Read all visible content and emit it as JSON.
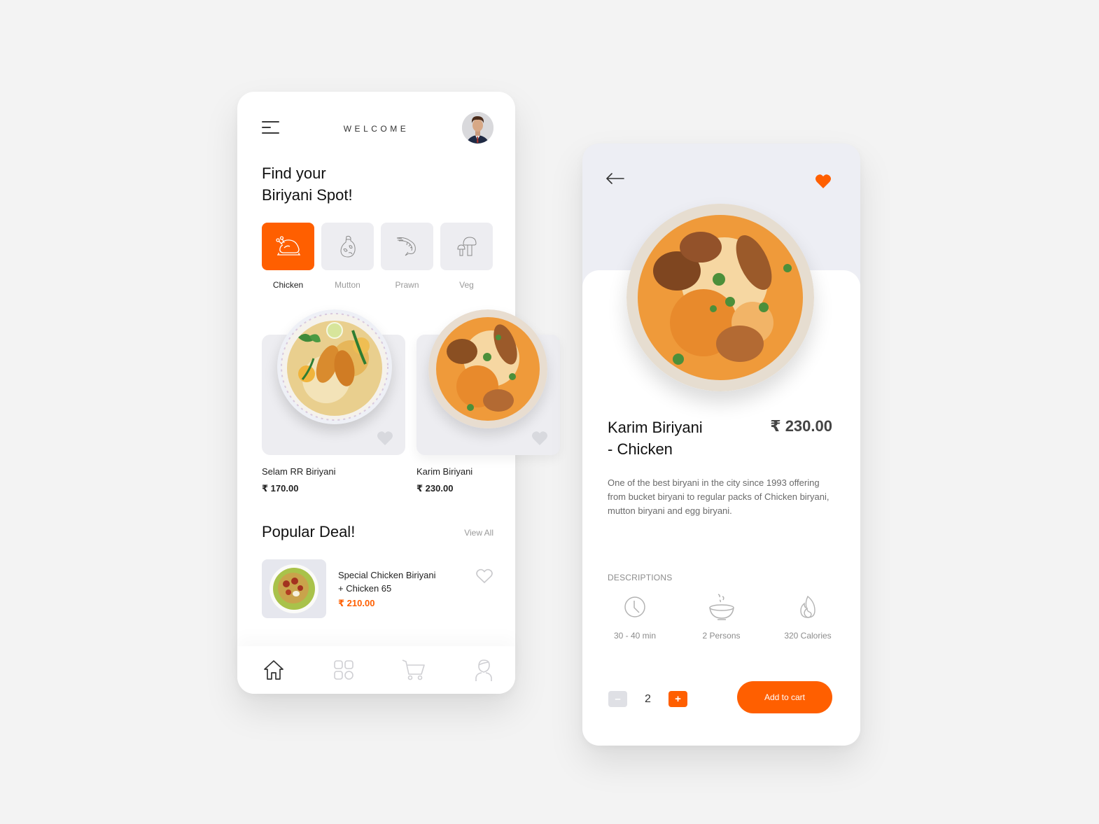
{
  "home": {
    "header": {
      "title": "WELCOME",
      "menu_icon": "hamburger-menu-icon",
      "avatar_icon": "user-avatar"
    },
    "headline": [
      "Find your",
      "Biriyani Spot!"
    ],
    "categories": [
      {
        "label": "Chicken",
        "icon": "chicken-icon",
        "active": true
      },
      {
        "label": "Mutton",
        "icon": "mutton-icon",
        "active": false
      },
      {
        "label": "Prawn",
        "icon": "prawn-icon",
        "active": false
      },
      {
        "label": "Veg",
        "icon": "mushroom-icon",
        "active": false
      }
    ],
    "featured": [
      {
        "name": "Selam RR Biriyani",
        "price": "₹ 170.00",
        "favorite": false
      },
      {
        "name": "Karim Biriyani",
        "price": "₹ 230.00",
        "favorite": false
      }
    ],
    "popular": {
      "title": "Popular Deal!",
      "view_all": "View All",
      "items": [
        {
          "name_line1": "Special Chicken Biriyani",
          "name_line2": "+ Chicken 65",
          "price": "₹ 210.00",
          "favorite": false
        }
      ]
    },
    "tabbar": [
      {
        "name": "home",
        "icon": "home-icon",
        "active": true
      },
      {
        "name": "categories",
        "icon": "grid-icon",
        "active": false
      },
      {
        "name": "cart",
        "icon": "cart-icon",
        "active": false
      },
      {
        "name": "profile",
        "icon": "profile-icon",
        "active": false
      }
    ]
  },
  "detail": {
    "title_line1": "Karim Biriyani",
    "title_line2": "- Chicken",
    "price": "₹ 230.00",
    "favorite": true,
    "description": "One of the best biryani in the city since 1993 offering from bucket biryani to regular packs of Chicken biryani, mutton biryani and egg biryani.",
    "section_label": "DESCRIPTIONS",
    "stats": [
      {
        "icon": "clock-icon",
        "label": "30 - 40 min"
      },
      {
        "icon": "bowl-icon",
        "label": "2 Persons"
      },
      {
        "icon": "flame-icon",
        "label": "320 Calories"
      }
    ],
    "quantity": {
      "minus": "–",
      "value": "2",
      "plus": "+"
    },
    "add_to_cart": "Add to cart"
  },
  "colors": {
    "accent": "#ff5f00",
    "card_bg": "#ededf1",
    "page_bg": "#f3f3f3"
  }
}
